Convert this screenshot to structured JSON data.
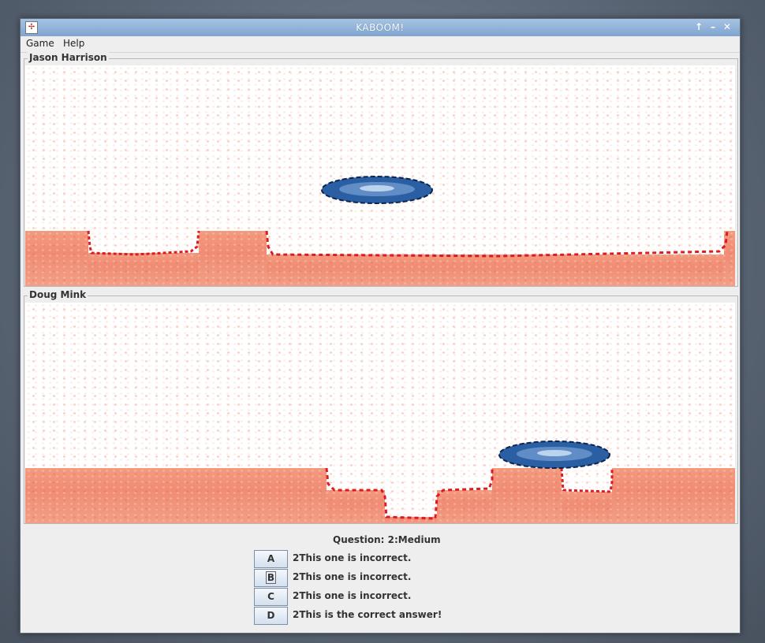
{
  "window": {
    "title": "KABOOM!"
  },
  "menu": [
    "Game",
    "Help"
  ],
  "players": [
    {
      "name": "Jason Harrison"
    },
    {
      "name": "Doug Mink"
    }
  ],
  "question": {
    "label": "Question: 2:Medium"
  },
  "answers": [
    {
      "letter": "A",
      "text": "2This one is incorrect."
    },
    {
      "letter": "B",
      "text": "2This one is incorrect."
    },
    {
      "letter": "C",
      "text": "2This one is incorrect."
    },
    {
      "letter": "D",
      "text": "2This is the correct answer!"
    }
  ],
  "icons": {
    "maximize": "up-arrow-icon",
    "minimize": "minimize-icon",
    "close": "close-icon"
  },
  "colors": {
    "ground": "#f08c74",
    "crater_edge": "#dd1a22",
    "cursor": "#2b5fa3"
  }
}
